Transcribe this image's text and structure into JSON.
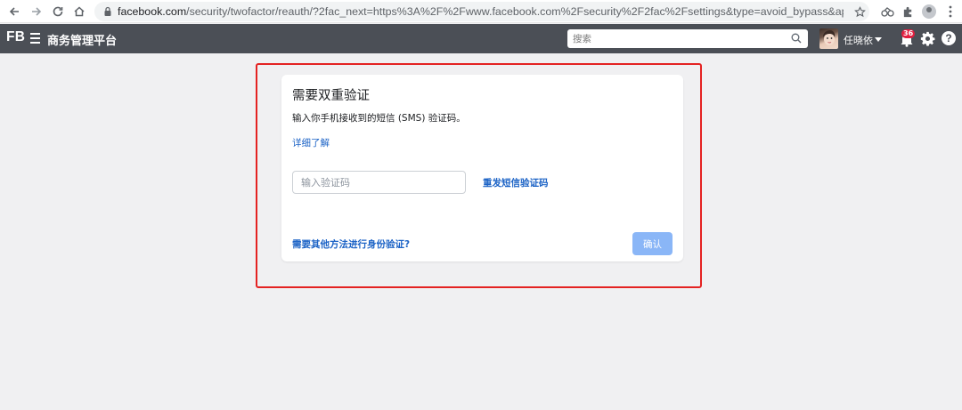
{
  "browser": {
    "url_host": "facebook.com",
    "url_path": "/security/twofactor/reauth/?2fac_next=https%3A%2F%2Fwww.facebook.com%2Fsecurity%2F2fac%2Fsettings&type=avoid_bypass&app_id=0&save_dev...",
    "icons": [
      "back-arrow-icon",
      "forward-arrow-icon",
      "reload-icon",
      "home-icon",
      "lock-icon",
      "star-icon",
      "extension-icon",
      "puzzle-icon",
      "profile-icon",
      "more-vert-icon"
    ]
  },
  "header": {
    "brand": "FB",
    "title": "商务管理平台",
    "search_placeholder": "搜索",
    "user_name": "任晓依",
    "notification_count": "36"
  },
  "dialog": {
    "title": "需要双重验证",
    "description": "输入你手机接收到的短信 (SMS) 验证码。",
    "learn_more": "详细了解",
    "code_placeholder": "输入验证码",
    "resend_label": "重发短信验证码",
    "other_method": "需要其他方法进行身份验证?",
    "confirm_label": "确认"
  },
  "colors": {
    "header_bg": "#4b4f56",
    "link": "#1c63c6",
    "button_disabled": "#8ab6f7",
    "highlight_border": "#e42222",
    "page_bg": "#f0f0f2"
  }
}
